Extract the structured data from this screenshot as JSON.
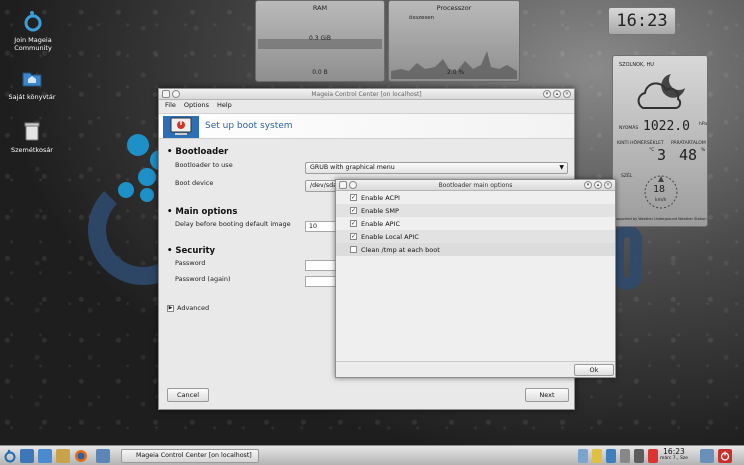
{
  "desktop": {
    "icons": [
      {
        "label": "Join Mageia Community",
        "icon": "mageia-icon"
      },
      {
        "label": "Saját könyvtár",
        "icon": "home-folder-icon"
      },
      {
        "label": "Szemétkosár",
        "icon": "trash-icon"
      }
    ]
  },
  "widgets": {
    "ram": {
      "title": "RAM",
      "top_value": "0.3 GiB",
      "bottom_value": "0.0 B"
    },
    "cpu": {
      "title": "Processzor",
      "label": "összesen",
      "bottom_value": "2.0 %"
    },
    "clock": {
      "time": "16:23"
    },
    "weather": {
      "city": "SZOLNOK, HU",
      "pressure_label": "NYOMÁS",
      "pressure": "1022.0",
      "pressure_unit": "hPa",
      "outside_temp_label": "KINTI HŐMÉRSÉKLET",
      "outside_temp": "3",
      "outside_temp_unit": "°C",
      "humidity_label": "PÁRATARTALOM",
      "humidity": "48",
      "humidity_unit": "%",
      "wind_label": "SZÉL",
      "wind_speed": "18",
      "wind_unit": "km/h",
      "footer": "Supported by Weather Underground Weather Station"
    }
  },
  "main_window": {
    "title": "Mageia Control Center  [on localhost]",
    "menu": [
      "File",
      "Options",
      "Help"
    ],
    "banner_title": "Set up boot system",
    "bootloader": {
      "heading": "Bootloader",
      "use_label": "Bootloader to use",
      "use_value": "GRUB with graphical menu",
      "device_label": "Boot device",
      "device_value": "/dev/sda"
    },
    "main_options": {
      "heading": "Main options",
      "delay_label": "Delay before booting default image",
      "delay_value": "10"
    },
    "security": {
      "heading": "Security",
      "password_label": "Password",
      "password_again_label": "Password (again)"
    },
    "advanced_label": "Advanced",
    "cancel_label": "Cancel",
    "next_label": "Next"
  },
  "dialog": {
    "title": "Bootloader main options",
    "options": [
      {
        "label": "Enable ACPI",
        "checked": true
      },
      {
        "label": "Enable SMP",
        "checked": true
      },
      {
        "label": "Enable APIC",
        "checked": true
      },
      {
        "label": "Enable Local APIC",
        "checked": true
      },
      {
        "label": "Clean /tmp at each boot",
        "checked": false
      }
    ],
    "ok_label": "Ok"
  },
  "taskbar": {
    "task_label": "Mageia Control Center  [on localhost]",
    "clock_time": "16:23",
    "clock_date": "márc 7., Sze"
  }
}
